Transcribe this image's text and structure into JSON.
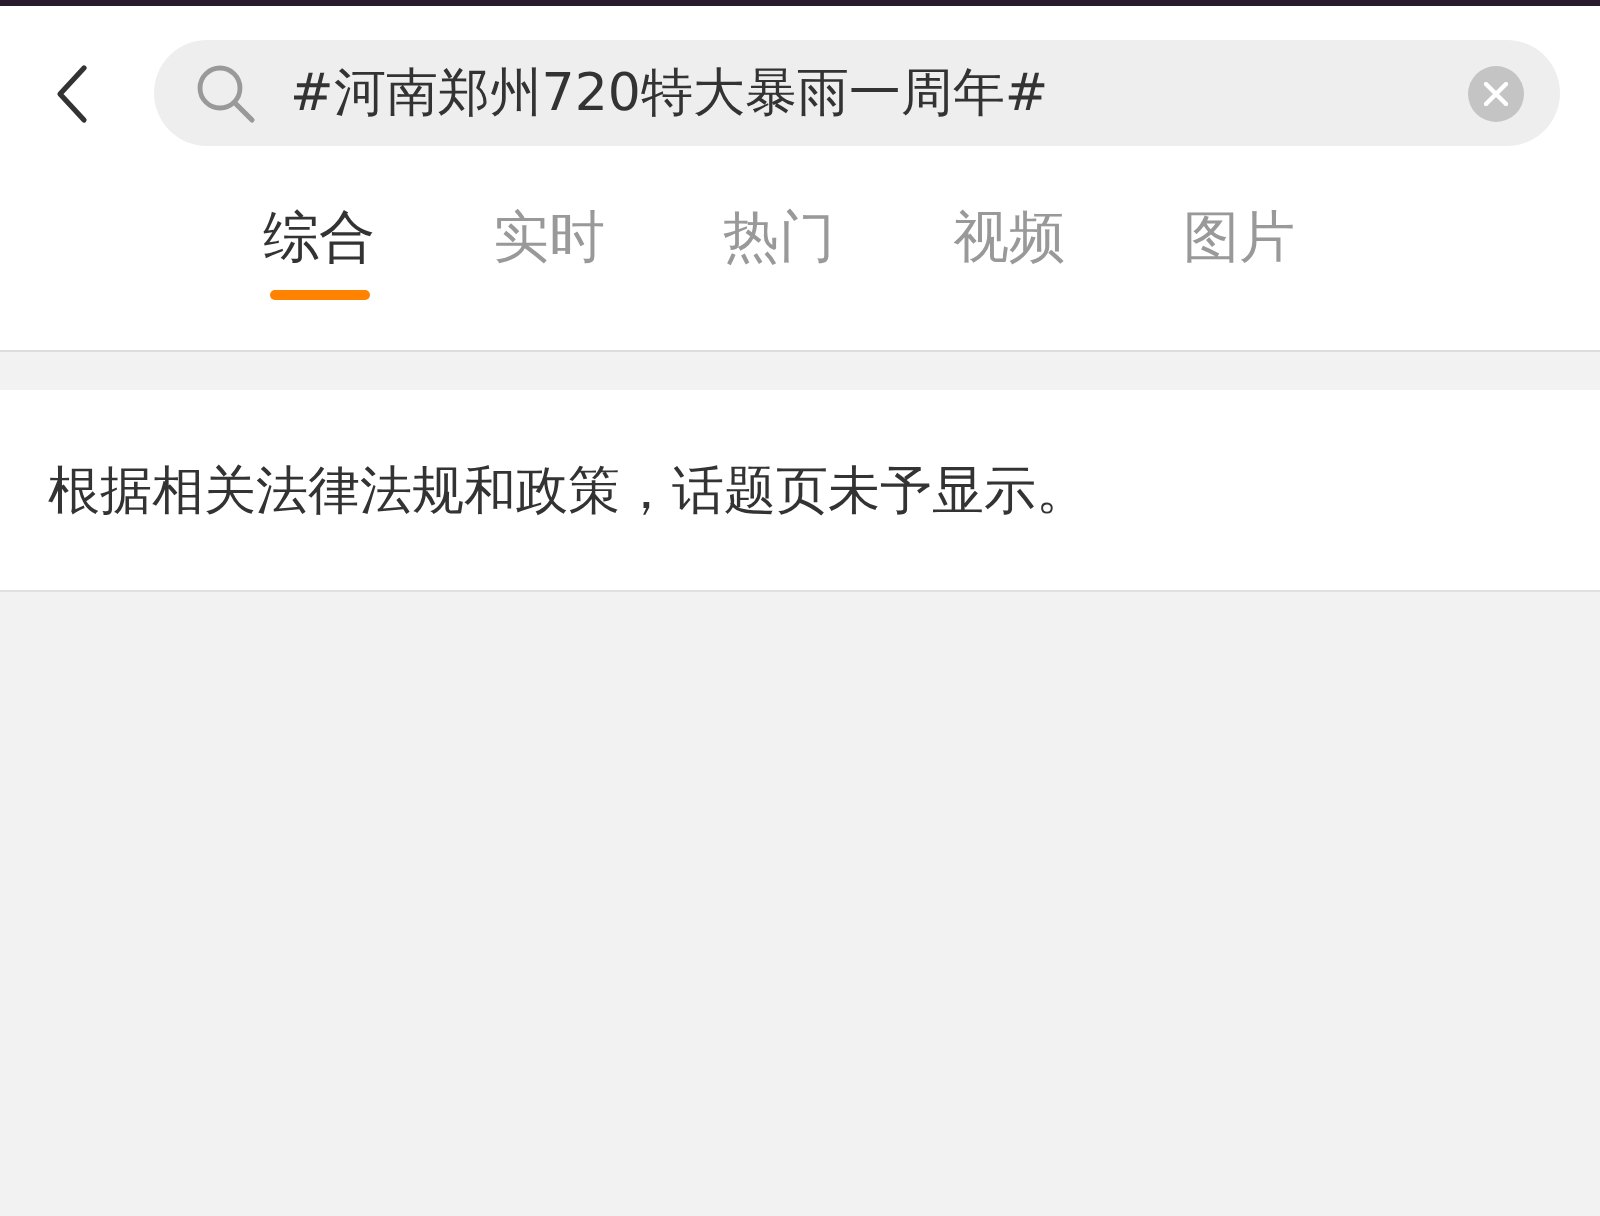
{
  "search": {
    "value": "#河南郑州720特大暴雨一周年#"
  },
  "tabs": [
    {
      "label": "综合",
      "selected": true
    },
    {
      "label": "实时",
      "selected": false
    },
    {
      "label": "热门",
      "selected": false
    },
    {
      "label": "视频",
      "selected": false
    },
    {
      "label": "图片",
      "selected": false
    }
  ],
  "notice": "根据相关法律法规和政策，话题页未予显示。"
}
